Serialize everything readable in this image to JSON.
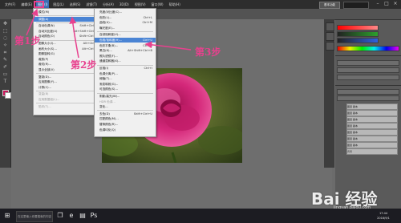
{
  "menubar": {
    "items": [
      "文件(F)",
      "编辑(E)",
      "图像(I)",
      "图层(L)",
      "选择(S)",
      "滤镜(T)",
      "分析(A)",
      "3D(D)",
      "视图(V)",
      "窗口(W)",
      "帮助(H)"
    ],
    "active_index": 2,
    "workspace_label": "基本功能"
  },
  "image_menu": {
    "items": [
      {
        "label": "模式(M)",
        "shortcut": "",
        "arrow": true,
        "disabled": false,
        "sep_after": true
      },
      {
        "label": "调整(A)",
        "shortcut": "",
        "arrow": true,
        "disabled": false,
        "highlight": true,
        "sep_after": true
      },
      {
        "label": "自动色调(N)",
        "shortcut": "Shift+Ctrl+L",
        "disabled": false
      },
      {
        "label": "自动对比度(U)",
        "shortcut": "Alt+Shift+Ctrl+L",
        "disabled": false
      },
      {
        "label": "自动颜色(O)",
        "shortcut": "Shift+Ctrl+B",
        "disabled": false,
        "sep_after": true
      },
      {
        "label": "图像大小(I)...",
        "shortcut": "Alt+Ctrl+I",
        "disabled": false
      },
      {
        "label": "画布大小(S)...",
        "shortcut": "Alt+Ctrl+C",
        "disabled": false
      },
      {
        "label": "图像旋转(G)",
        "shortcut": "",
        "arrow": true,
        "disabled": false
      },
      {
        "label": "裁剪(P)",
        "shortcut": "",
        "disabled": false
      },
      {
        "label": "裁切(R)...",
        "shortcut": "",
        "disabled": false
      },
      {
        "label": "显示全部(V)",
        "shortcut": "",
        "disabled": false,
        "sep_after": true
      },
      {
        "label": "复制(D)...",
        "shortcut": "",
        "disabled": false
      },
      {
        "label": "应用图像(Y)...",
        "shortcut": "",
        "disabled": false
      },
      {
        "label": "计算(C)...",
        "shortcut": "",
        "disabled": false,
        "sep_after": true
      },
      {
        "label": "变量(B)",
        "shortcut": "",
        "arrow": true,
        "disabled": true
      },
      {
        "label": "应用数据组(L)...",
        "shortcut": "",
        "disabled": true,
        "sep_after": true
      },
      {
        "label": "陷印(T)...",
        "shortcut": "",
        "disabled": true
      }
    ]
  },
  "adjust_menu": {
    "items": [
      {
        "label": "亮度/对比度(C)...",
        "shortcut": ""
      },
      {
        "label": "色阶(L)...",
        "shortcut": "Ctrl+L"
      },
      {
        "label": "曲线(U)...",
        "shortcut": "Ctrl+M"
      },
      {
        "label": "曝光度(E)...",
        "shortcut": "",
        "sep_after": true
      },
      {
        "label": "自然饱和度(V)...",
        "shortcut": ""
      },
      {
        "label": "色相/饱和度(H)...",
        "shortcut": "Ctrl+U",
        "highlight": true
      },
      {
        "label": "色彩平衡(B)...",
        "shortcut": "Ctrl+B"
      },
      {
        "label": "黑白(K)...",
        "shortcut": "Alt+Shift+Ctrl+B"
      },
      {
        "label": "照片滤镜(F)...",
        "shortcut": ""
      },
      {
        "label": "通道混和器(X)...",
        "shortcut": "",
        "sep_after": true
      },
      {
        "label": "反相(I)",
        "shortcut": "Ctrl+I"
      },
      {
        "label": "色调分离(P)...",
        "shortcut": ""
      },
      {
        "label": "阈值(T)...",
        "shortcut": ""
      },
      {
        "label": "渐变映射(G)...",
        "shortcut": ""
      },
      {
        "label": "可选颜色(S)...",
        "shortcut": "",
        "sep_after": true
      },
      {
        "label": "阴影/高光(W)...",
        "shortcut": ""
      },
      {
        "label": "HDR 色调...",
        "shortcut": "",
        "disabled": true
      },
      {
        "label": "变化...",
        "shortcut": "",
        "sep_after": true
      },
      {
        "label": "去色(D)",
        "shortcut": "Shift+Ctrl+U"
      },
      {
        "label": "匹配颜色(M)...",
        "shortcut": ""
      },
      {
        "label": "替换颜色(R)...",
        "shortcut": ""
      },
      {
        "label": "色调均化(Q)",
        "shortcut": ""
      }
    ]
  },
  "annotations": {
    "step1": "第1步",
    "step2": "第2步",
    "step3": "第3步"
  },
  "layers": [
    "图层 副本",
    "图层 副本",
    "图层 副本",
    "图层 副本",
    "图层 副本",
    "图层 副本",
    "图层 副本",
    "背景"
  ],
  "taskbar": {
    "search_placeholder": "在这里输入你要搜索的内容",
    "time": "17:44",
    "date": "2016/9/1"
  },
  "watermark": {
    "text": "Bai 经验",
    "url": "jingyan.baidu.com"
  },
  "colors": {
    "accent": "#e8418e",
    "highlight": "#4a84d4",
    "foreground": "#c8165a"
  }
}
